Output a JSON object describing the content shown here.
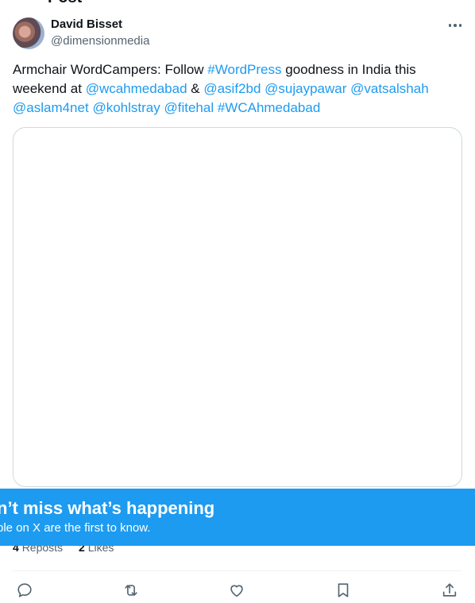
{
  "header": {
    "title_partial": "Post"
  },
  "author": {
    "name": "David Bisset",
    "handle": "@dimensionmedia"
  },
  "more_icon": "more-horizontal-icon",
  "tweet": {
    "text_prefix": "Armchair WordCampers: Follow ",
    "hashtag_wordpress": "#WordPress",
    "text_mid": " goodness in India this weekend at ",
    "mention_wcahmedabad": "@wcahmedabad",
    "amp": " & ",
    "mention_asif2bd": "@asif2bd",
    "mention_sujaypawar": "@sujaypawar",
    "mention_vatsalshah": "@vatsalshah",
    "mention_aslam4net": "@aslam4net",
    "mention_kohlstray": "@kohlstray",
    "mention_fitehal": "@fitehal",
    "hashtag_wcahmedabad": "#WCAhmedabad"
  },
  "stats": {
    "reposts_count": "4",
    "reposts_label": "Reposts",
    "likes_count": "2",
    "likes_label": "Likes"
  },
  "actions": [
    "reply-icon",
    "repost-icon",
    "like-icon",
    "bookmark-icon",
    "share-icon"
  ],
  "banner": {
    "title": "n’t miss what’s happening",
    "subtitle": "ple on X are the first to know."
  },
  "colors": {
    "accent": "#1d9bf0",
    "text": "#0f1419",
    "muted": "#536471",
    "border": "#cfd9de"
  }
}
